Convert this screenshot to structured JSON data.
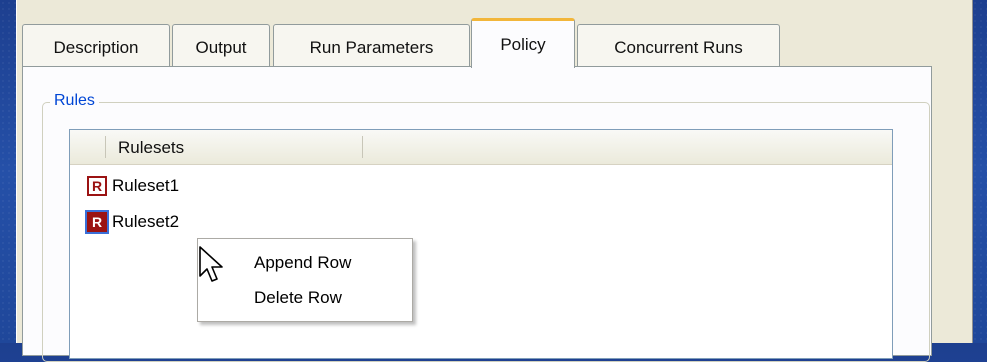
{
  "tabs": [
    {
      "label": "Description",
      "active": false
    },
    {
      "label": "Output",
      "active": false
    },
    {
      "label": "Run Parameters",
      "active": false
    },
    {
      "label": "Policy",
      "active": true
    },
    {
      "label": "Concurrent Runs",
      "active": false
    }
  ],
  "group": {
    "title": "Rules"
  },
  "list": {
    "column_header": "Rulesets",
    "rows": [
      {
        "icon": "ruleset-icon",
        "icon_glyph": "R",
        "label": "Ruleset1",
        "selected": false
      },
      {
        "icon": "ruleset-icon",
        "icon_glyph": "R",
        "label": "Ruleset2",
        "selected": true
      }
    ]
  },
  "context_menu": {
    "items": [
      {
        "label": "Append Row"
      },
      {
        "label": "Delete Row"
      }
    ]
  },
  "colors": {
    "group_title": "#0046d5",
    "active_tab_accent": "#f2b63a",
    "rule_icon": "#9b1313"
  }
}
